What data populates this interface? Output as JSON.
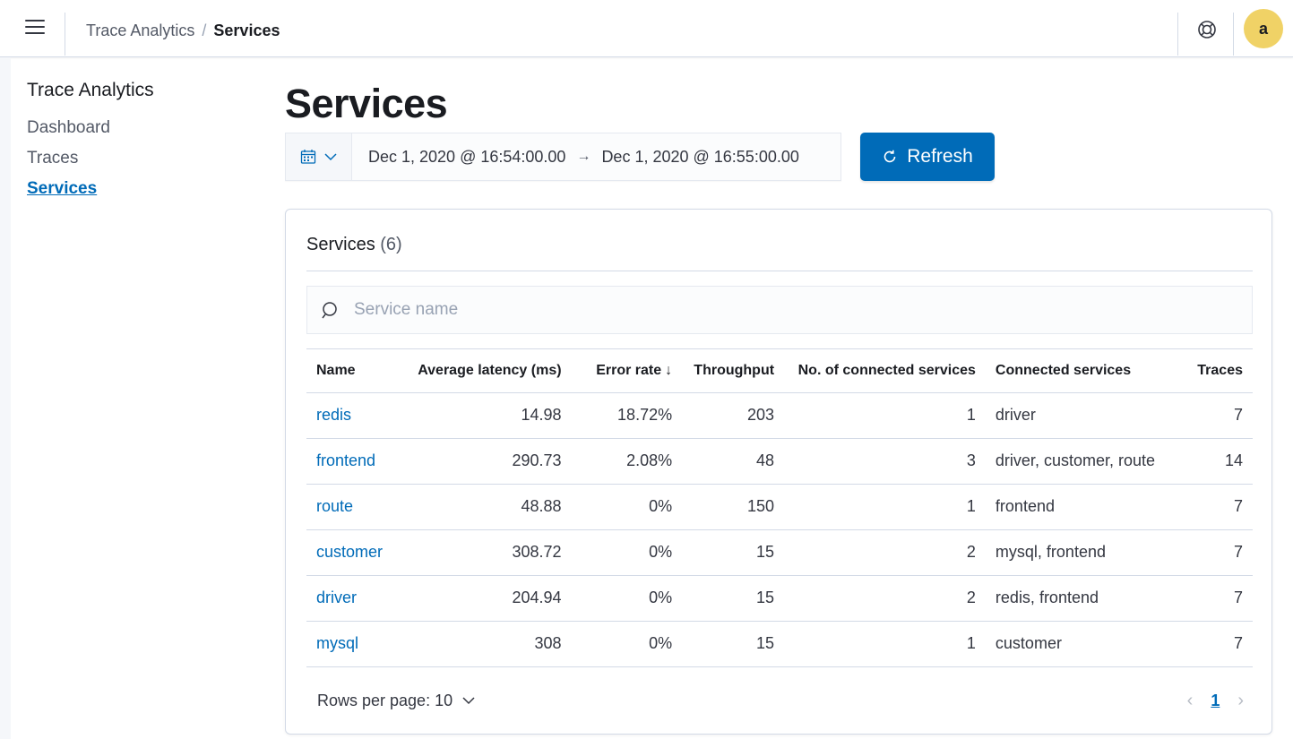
{
  "header": {
    "breadcrumbs": [
      "Trace Analytics",
      "Services"
    ],
    "avatar_letter": "a"
  },
  "sidenav": {
    "title": "Trace Analytics",
    "items": [
      {
        "label": "Dashboard",
        "active": false
      },
      {
        "label": "Traces",
        "active": false
      },
      {
        "label": "Services",
        "active": true
      }
    ]
  },
  "page": {
    "title": "Services"
  },
  "datepicker": {
    "start": "Dec 1, 2020 @ 16:54:00.00",
    "arrow": "→",
    "end": "Dec 1, 2020 @ 16:55:00.00"
  },
  "refresh": {
    "label": "Refresh"
  },
  "panel": {
    "title": "Services",
    "count": "(6)",
    "search_placeholder": "Service name",
    "columns": [
      "Name",
      "Average latency (ms)",
      "Error rate",
      "Throughput",
      "No. of connected services",
      "Connected services",
      "Traces"
    ],
    "sort_column": "Error rate",
    "rows": [
      {
        "name": "redis",
        "latency": "14.98",
        "error_rate": "18.72%",
        "throughput": "203",
        "num_connected": "1",
        "connected": "driver",
        "traces": "7"
      },
      {
        "name": "frontend",
        "latency": "290.73",
        "error_rate": "2.08%",
        "throughput": "48",
        "num_connected": "3",
        "connected": "driver, customer, route",
        "traces": "14"
      },
      {
        "name": "route",
        "latency": "48.88",
        "error_rate": "0%",
        "throughput": "150",
        "num_connected": "1",
        "connected": "frontend",
        "traces": "7"
      },
      {
        "name": "customer",
        "latency": "308.72",
        "error_rate": "0%",
        "throughput": "15",
        "num_connected": "2",
        "connected": "mysql, frontend",
        "traces": "7"
      },
      {
        "name": "driver",
        "latency": "204.94",
        "error_rate": "0%",
        "throughput": "15",
        "num_connected": "2",
        "connected": "redis, frontend",
        "traces": "7"
      },
      {
        "name": "mysql",
        "latency": "308",
        "error_rate": "0%",
        "throughput": "15",
        "num_connected": "1",
        "connected": "customer",
        "traces": "7"
      }
    ],
    "rows_per_page": "Rows per page: 10",
    "current_page": "1"
  },
  "colors": {
    "accent": "#006bb8",
    "avatar_bg": "#f0d266"
  }
}
